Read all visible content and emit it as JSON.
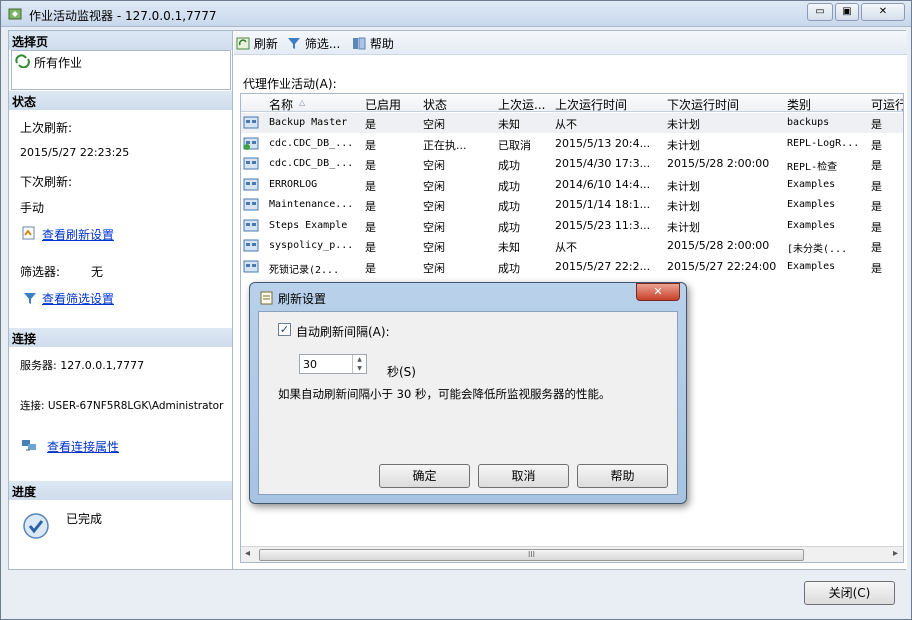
{
  "window": {
    "title": "作业活动监视器 - 127.0.0.1,7777",
    "minimize": "▭",
    "maximize": "▣",
    "close": "✕"
  },
  "left": {
    "select_page": {
      "header": "选择页",
      "item": "所有作业"
    },
    "status": {
      "header": "状态",
      "last_refresh_label": "上次刷新:",
      "last_refresh_value": "2015/5/27 22:23:25",
      "next_refresh_label": "下次刷新:",
      "next_refresh_value": "手动",
      "refresh_settings_link": "查看刷新设置",
      "filter_label": "筛选器:",
      "filter_value": "无",
      "filter_settings_link": "查看筛选设置"
    },
    "connection": {
      "header": "连接",
      "server": "服务器: 127.0.0.1,7777",
      "conn": "连接: USER-67NF5R8LGK\\Administrator",
      "props_link": "查看连接属性"
    },
    "progress": {
      "header": "进度",
      "value": "已完成"
    }
  },
  "toolbar": {
    "refresh": "刷新",
    "filter": "筛选...",
    "help": "帮助"
  },
  "main": {
    "grid_label": "代理作业活动(A):",
    "columns": [
      "名称",
      "已启用",
      "状态",
      "上次运...",
      "上次运行时间",
      "下次运行时间",
      "类别",
      "可运行"
    ],
    "sort_arrow": "△",
    "rows": [
      [
        "Backup Master",
        "是",
        "空闲",
        "未知",
        "从不",
        "未计划",
        "backups",
        "是"
      ],
      [
        "cdc.CDC_DB_...",
        "是",
        "正在执...",
        "已取消",
        "2015/5/13 20:4...",
        "未计划",
        "REPL-LogR...",
        "是"
      ],
      [
        "cdc.CDC_DB_...",
        "是",
        "空闲",
        "成功",
        "2015/4/30 17:3...",
        "2015/5/28 2:00:00",
        "REPL-检查",
        "是"
      ],
      [
        "ERRORLOG",
        "是",
        "空闲",
        "成功",
        "2014/6/10 14:4...",
        "未计划",
        "Examples",
        "是"
      ],
      [
        "Maintenance...",
        "是",
        "空闲",
        "成功",
        "2015/1/14 18:1...",
        "未计划",
        "Examples",
        "是"
      ],
      [
        "Steps Example",
        "是",
        "空闲",
        "成功",
        "2015/5/23 11:3...",
        "未计划",
        "Examples",
        "是"
      ],
      [
        "syspolicy_p...",
        "是",
        "空闲",
        "未知",
        "从不",
        "2015/5/28 2:00:00",
        "[未分类(...",
        "是"
      ],
      [
        "死锁记录(2...",
        "是",
        "空闲",
        "成功",
        "2015/5/27 22:2...",
        "2015/5/27 22:24:00",
        "Examples",
        "是"
      ]
    ],
    "scroll_grip": "III",
    "scroll_left": "◂",
    "scroll_right": "▸"
  },
  "footer": {
    "close_button": "关闭(C)"
  },
  "dialog": {
    "title": "刷新设置",
    "close": "✕",
    "auto_refresh_label": "自动刷新间隔(A):",
    "auto_refresh_checked": "✓",
    "interval_value": "30",
    "spin_up": "▲",
    "spin_down": "▼",
    "seconds_label": "秒(S)",
    "warning": "如果自动刷新间隔小于 30 秒，可能会降低所监视服务器的性能。",
    "ok": "确定",
    "cancel": "取消",
    "help": "帮助"
  }
}
